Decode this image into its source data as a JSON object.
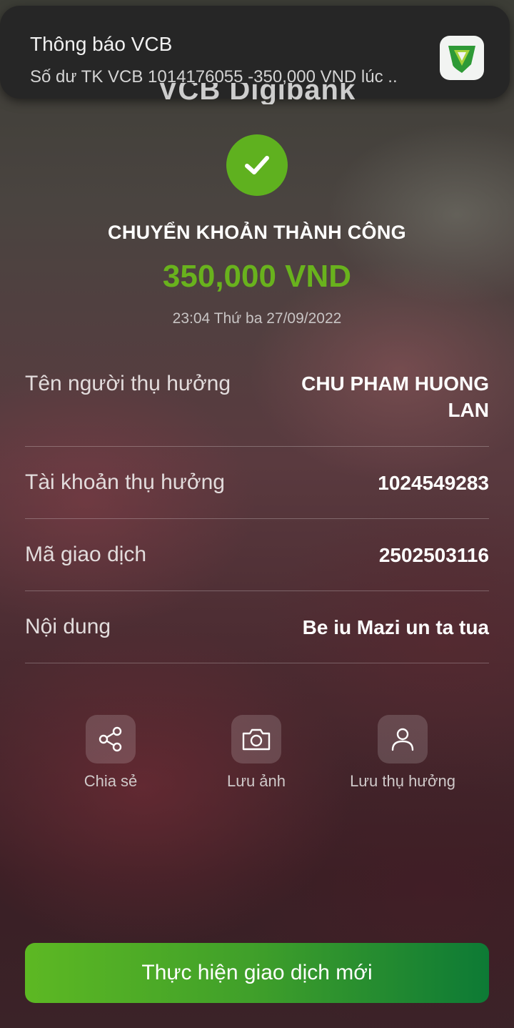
{
  "notification": {
    "title": "Thông báo VCB",
    "body": "Số dư TK VCB 1014176055 -350,000 VND lúc ..",
    "app_icon": "vcb-logo-icon"
  },
  "header": {
    "brand": "VCB Digibank"
  },
  "status": {
    "icon": "check-icon",
    "title": "CHUYỂN KHOẢN THÀNH CÔNG",
    "amount": "350,000 VND",
    "datetime": "23:04 Thứ ba 27/09/2022",
    "accent_color": "#69b21d"
  },
  "details": [
    {
      "label": "Tên người thụ hưởng",
      "value": "CHU PHAM HUONG LAN"
    },
    {
      "label": "Tài khoản thụ hưởng",
      "value": "1024549283"
    },
    {
      "label": "Mã giao dịch",
      "value": "2502503116"
    },
    {
      "label": "Nội dung",
      "value": "Be iu Mazi un ta tua"
    }
  ],
  "actions": [
    {
      "label": "Chia sẻ",
      "icon": "share-icon"
    },
    {
      "label": "Lưu ảnh",
      "icon": "camera-icon"
    },
    {
      "label": "Lưu thụ hưởng",
      "icon": "user-icon"
    }
  ],
  "cta": {
    "label": "Thực hiện giao dịch mới"
  }
}
